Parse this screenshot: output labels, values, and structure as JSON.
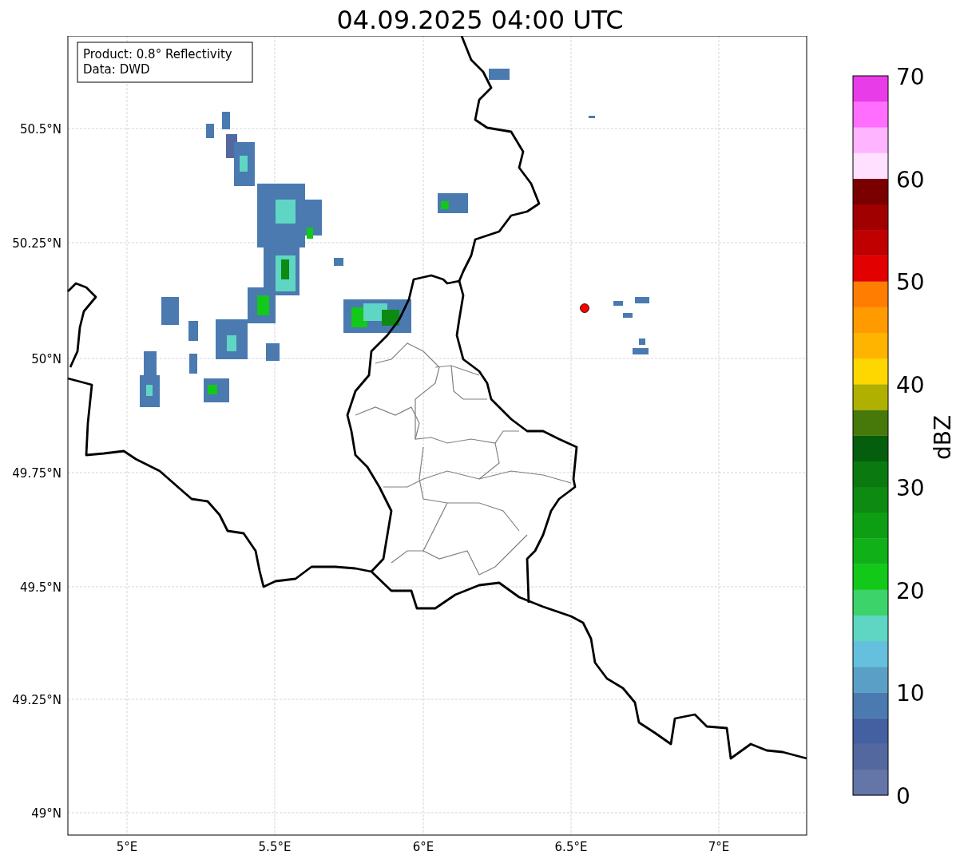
{
  "title": "04.09.2025 04:00 UTC",
  "info_box": [
    "Product: 0.8° Reflectivity",
    "Data: DWD"
  ],
  "map": {
    "lat_labels": [
      "50.5°N",
      "50.25°N",
      "50°N",
      "49.75°N",
      "49.5°N",
      "49.25°N",
      "49°N"
    ],
    "lon_labels": [
      "5°E",
      "5.5°E",
      "6°E",
      "6.5°E",
      "7°E"
    ]
  },
  "colorbar": {
    "label": "dBZ",
    "tick_labels": [
      "70",
      "60",
      "50",
      "40",
      "30",
      "20",
      "10",
      "0"
    ],
    "segments": [
      {
        "color": "#6475a8"
      },
      {
        "color": "#5468a0"
      },
      {
        "color": "#4560a0"
      },
      {
        "color": "#4a7ab0"
      },
      {
        "color": "#5a9fc6"
      },
      {
        "color": "#64c0dc"
      },
      {
        "color": "#5fd6c4"
      },
      {
        "color": "#3dd36b"
      },
      {
        "color": "#12c818"
      },
      {
        "color": "#10b018"
      },
      {
        "color": "#0e9e14"
      },
      {
        "color": "#0c8a12"
      },
      {
        "color": "#0a7a10"
      },
      {
        "color": "#055e0b"
      },
      {
        "color": "#47780a"
      },
      {
        "color": "#b0b000"
      },
      {
        "color": "#ffd700"
      },
      {
        "color": "#ffb400"
      },
      {
        "color": "#ff9b00"
      },
      {
        "color": "#ff7d00"
      },
      {
        "color": "#e20000"
      },
      {
        "color": "#c00000"
      },
      {
        "color": "#a00000"
      },
      {
        "color": "#7a0000"
      },
      {
        "color": "#ffe0ff"
      },
      {
        "color": "#ffb4ff"
      },
      {
        "color": "#ff6eff"
      },
      {
        "color": "#e83ce8"
      }
    ]
  }
}
